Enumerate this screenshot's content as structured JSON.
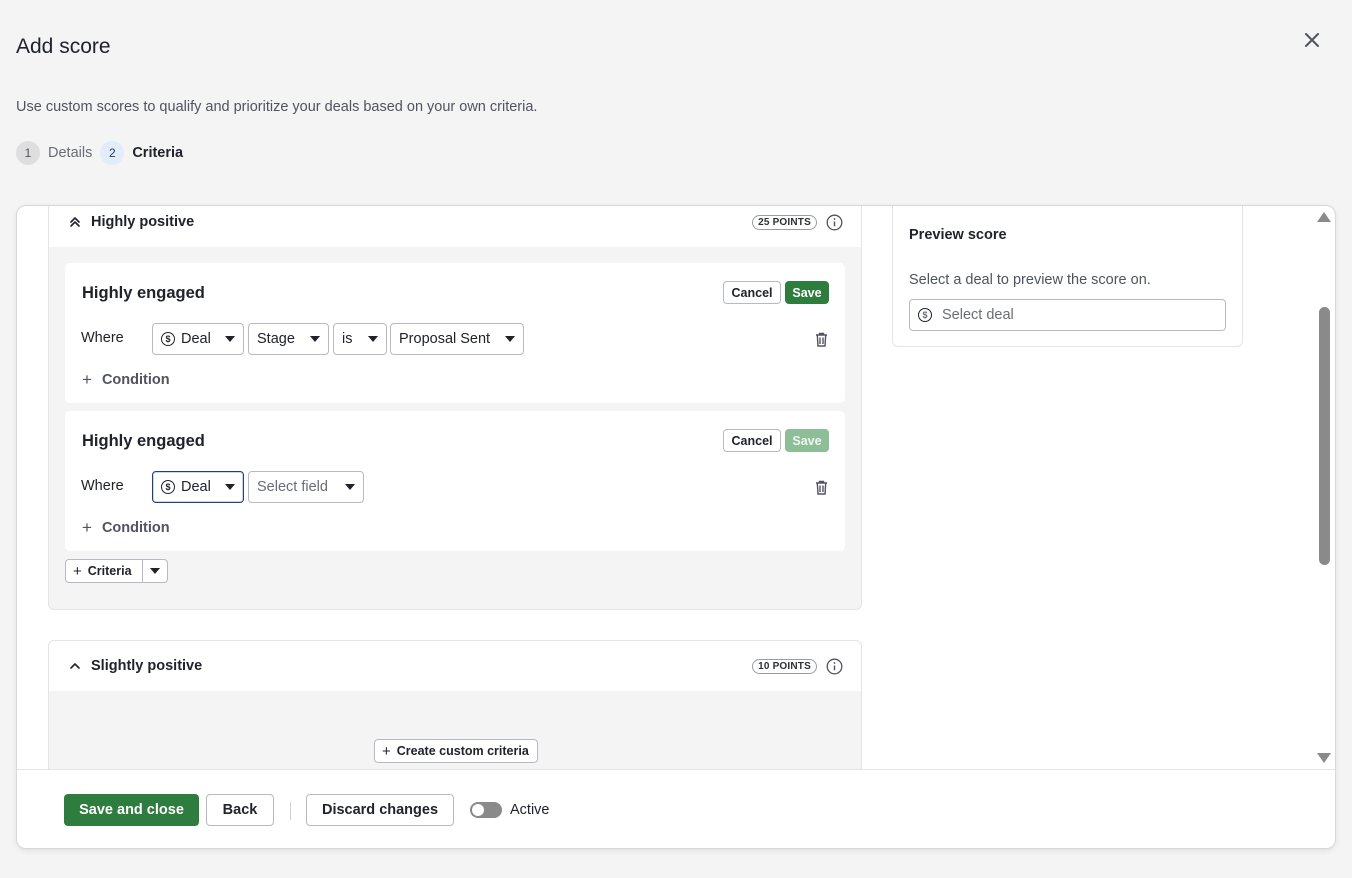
{
  "dialog": {
    "title": "Add score",
    "subtitle": "Use custom scores to qualify and prioritize your deals based on your own criteria.",
    "steps": [
      {
        "num": "1",
        "label": "Details",
        "state": "done"
      },
      {
        "num": "2",
        "label": "Criteria",
        "state": "current"
      }
    ]
  },
  "groups": {
    "highly_positive": {
      "title": "Highly positive",
      "points": "25 POINTS",
      "criteria": [
        {
          "title": "Highly engaged",
          "cancel": "Cancel",
          "save": "Save",
          "where": "Where",
          "object": "Deal",
          "field": "Stage",
          "operator": "is",
          "value": "Proposal Sent",
          "add_condition": "Condition"
        },
        {
          "title": "Highly engaged",
          "cancel": "Cancel",
          "save": "Save",
          "where": "Where",
          "object": "Deal",
          "field_placeholder": "Select field",
          "add_condition": "Condition"
        }
      ],
      "add_criteria": "Criteria"
    },
    "slightly_positive": {
      "title": "Slightly positive",
      "points": "10 POINTS",
      "create_custom": "Create custom criteria"
    }
  },
  "preview": {
    "title": "Preview score",
    "description": "Select a deal to preview the score on.",
    "placeholder": "Select deal"
  },
  "footer": {
    "save_and_close": "Save and close",
    "back": "Back",
    "discard": "Discard changes",
    "active_label": "Active",
    "active": false
  },
  "colors": {
    "primary": "#2f7d3e",
    "primary_disabled": "#8ebe98",
    "focus": "#1f3f75"
  }
}
